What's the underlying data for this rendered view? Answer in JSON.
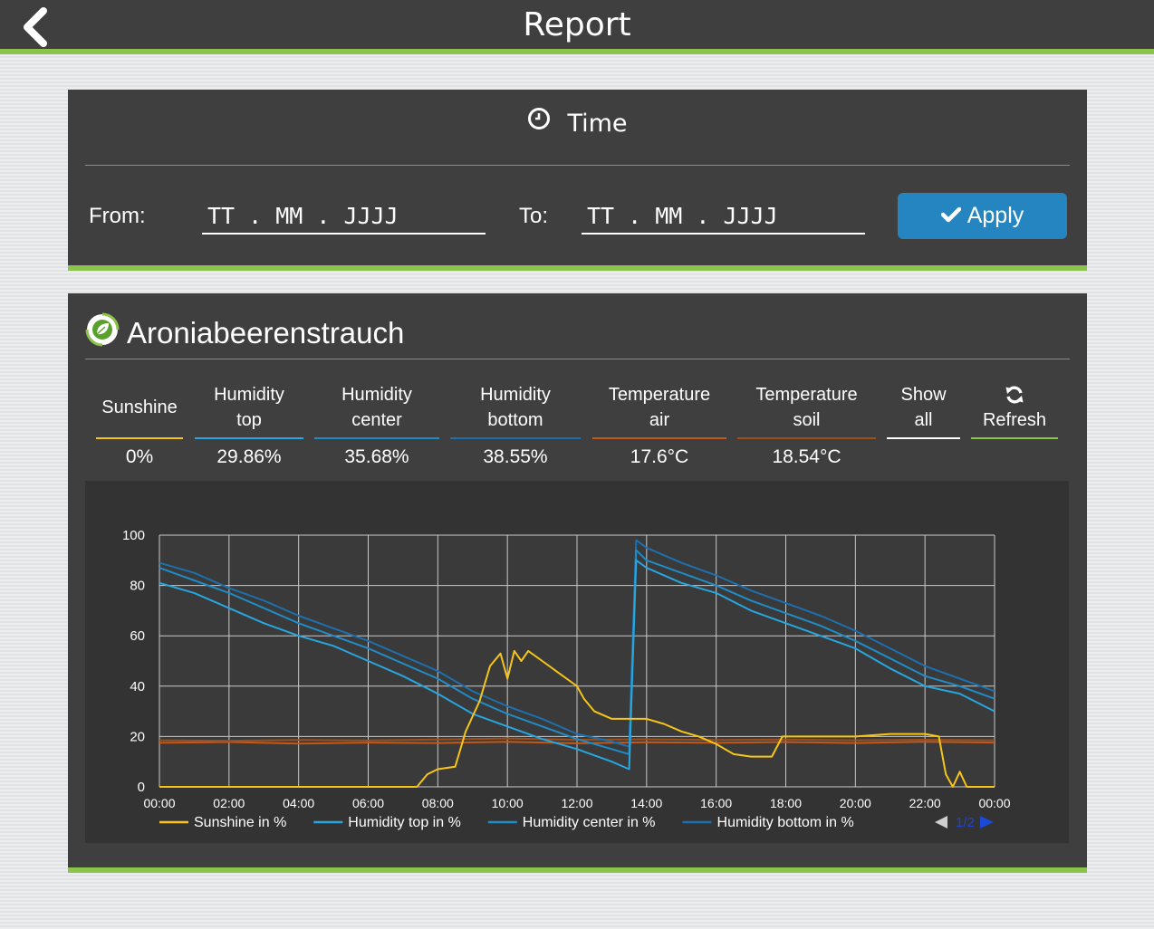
{
  "header": {
    "title": "Report"
  },
  "time": {
    "title": "Time",
    "from_label": "From:",
    "to_label": "To:",
    "from_placeholder": "TT . MM . JJJJ",
    "to_placeholder": "TT . MM . JJJJ",
    "apply_label": "Apply"
  },
  "plant": {
    "name": "Aroniabeerenstrauch",
    "tabs": [
      {
        "line1": "Sunshine",
        "line2": "",
        "value": "0%",
        "color": "#f5c518"
      },
      {
        "line1": "Humidity",
        "line2": "top",
        "value": "29.86%",
        "color": "#27a6e0"
      },
      {
        "line1": "Humidity",
        "line2": "center",
        "value": "35.68%",
        "color": "#1f8cc8"
      },
      {
        "line1": "Humidity",
        "line2": "bottom",
        "value": "38.55%",
        "color": "#1d6fad"
      },
      {
        "line1": "Temperature",
        "line2": "air",
        "value": "17.6°C",
        "color": "#c2581a"
      },
      {
        "line1": "Temperature",
        "line2": "soil",
        "value": "18.54°C",
        "color": "#9e4e1b"
      },
      {
        "line1": "Show",
        "line2": "all",
        "value": "",
        "color": "#ffffff"
      },
      {
        "line1": "Refresh",
        "line2": "",
        "value": "",
        "color": "#8cc34a",
        "icon": "refresh-icon"
      }
    ]
  },
  "chart_data": {
    "type": "line",
    "x": [
      "00:00",
      "02:00",
      "04:00",
      "06:00",
      "08:00",
      "10:00",
      "12:00",
      "14:00",
      "16:00",
      "18:00",
      "20:00",
      "22:00",
      "00:00"
    ],
    "ylim": [
      0,
      100
    ],
    "yticks": [
      0,
      20,
      40,
      60,
      80,
      100
    ],
    "grid": true,
    "legend_position": "bottom",
    "pager": "1/2",
    "series": [
      {
        "name": "Sunshine in %",
        "color": "#f5c518",
        "points": [
          [
            0,
            0
          ],
          [
            7.4,
            0
          ],
          [
            7.7,
            5
          ],
          [
            8.0,
            7
          ],
          [
            8.5,
            8
          ],
          [
            8.8,
            22
          ],
          [
            9.2,
            34
          ],
          [
            9.5,
            48
          ],
          [
            9.8,
            53
          ],
          [
            10.0,
            43
          ],
          [
            10.2,
            54
          ],
          [
            10.4,
            50
          ],
          [
            10.6,
            54
          ],
          [
            11.0,
            50
          ],
          [
            11.5,
            45
          ],
          [
            12.0,
            40
          ],
          [
            12.2,
            35
          ],
          [
            12.5,
            30
          ],
          [
            13.0,
            27
          ],
          [
            13.5,
            27
          ],
          [
            14.0,
            27
          ],
          [
            14.5,
            25
          ],
          [
            15.0,
            22
          ],
          [
            15.5,
            20
          ],
          [
            16.0,
            17
          ],
          [
            16.5,
            13
          ],
          [
            17.0,
            12
          ],
          [
            17.6,
            12
          ],
          [
            17.9,
            20
          ],
          [
            18.5,
            20
          ],
          [
            19.0,
            20
          ],
          [
            20.0,
            20
          ],
          [
            21.0,
            21
          ],
          [
            22.0,
            21
          ],
          [
            22.4,
            20
          ],
          [
            22.6,
            5
          ],
          [
            22.8,
            0
          ],
          [
            23.0,
            6
          ],
          [
            23.2,
            0
          ],
          [
            24,
            0
          ]
        ]
      },
      {
        "name": "Humidity top in %",
        "color": "#27a6e0",
        "points": [
          [
            0,
            81
          ],
          [
            1,
            77
          ],
          [
            2,
            71
          ],
          [
            3,
            65
          ],
          [
            4,
            60
          ],
          [
            5,
            56
          ],
          [
            6,
            50
          ],
          [
            7,
            44
          ],
          [
            8,
            37
          ],
          [
            9,
            29
          ],
          [
            10,
            24
          ],
          [
            11,
            19
          ],
          [
            12,
            15
          ],
          [
            13,
            10
          ],
          [
            13.5,
            7
          ],
          [
            13.7,
            90
          ],
          [
            14,
            87
          ],
          [
            15,
            81
          ],
          [
            16,
            77
          ],
          [
            17,
            70
          ],
          [
            18,
            65
          ],
          [
            19,
            60
          ],
          [
            20,
            55
          ],
          [
            21,
            47
          ],
          [
            22,
            40
          ],
          [
            23,
            37
          ],
          [
            24,
            30
          ]
        ]
      },
      {
        "name": "Humidity center in %",
        "color": "#1f8cc8",
        "points": [
          [
            0,
            87
          ],
          [
            1,
            82
          ],
          [
            2,
            77
          ],
          [
            3,
            71
          ],
          [
            4,
            65
          ],
          [
            5,
            60
          ],
          [
            6,
            55
          ],
          [
            7,
            49
          ],
          [
            8,
            43
          ],
          [
            9,
            35
          ],
          [
            10,
            29
          ],
          [
            11,
            24
          ],
          [
            12,
            19
          ],
          [
            13,
            15
          ],
          [
            13.5,
            13
          ],
          [
            13.7,
            94
          ],
          [
            14,
            90
          ],
          [
            15,
            85
          ],
          [
            16,
            80
          ],
          [
            17,
            74
          ],
          [
            18,
            69
          ],
          [
            19,
            64
          ],
          [
            20,
            58
          ],
          [
            21,
            51
          ],
          [
            22,
            44
          ],
          [
            23,
            40
          ],
          [
            24,
            35
          ]
        ]
      },
      {
        "name": "Humidity bottom in %",
        "color": "#1d6fad",
        "points": [
          [
            0,
            89
          ],
          [
            1,
            85
          ],
          [
            2,
            79
          ],
          [
            3,
            74
          ],
          [
            4,
            68
          ],
          [
            5,
            63
          ],
          [
            6,
            58
          ],
          [
            7,
            52
          ],
          [
            8,
            46
          ],
          [
            9,
            38
          ],
          [
            10,
            32
          ],
          [
            11,
            27
          ],
          [
            12,
            21
          ],
          [
            13,
            18
          ],
          [
            13.5,
            16
          ],
          [
            13.7,
            98
          ],
          [
            14,
            95
          ],
          [
            15,
            89
          ],
          [
            16,
            84
          ],
          [
            17,
            78
          ],
          [
            18,
            73
          ],
          [
            19,
            68
          ],
          [
            20,
            62
          ],
          [
            21,
            55
          ],
          [
            22,
            48
          ],
          [
            23,
            43
          ],
          [
            24,
            38
          ]
        ]
      },
      {
        "name": "Temperature air",
        "color": "#c2581a",
        "points": [
          [
            0,
            17.5
          ],
          [
            2,
            17.8
          ],
          [
            4,
            17.2
          ],
          [
            6,
            17.6
          ],
          [
            8,
            17.4
          ],
          [
            10,
            17.9
          ],
          [
            12,
            17.3
          ],
          [
            14,
            17.7
          ],
          [
            16,
            17.5
          ],
          [
            18,
            17.8
          ],
          [
            20,
            17.4
          ],
          [
            22,
            17.9
          ],
          [
            24,
            17.6
          ]
        ]
      },
      {
        "name": "Temperature soil",
        "color": "#9e4e1b",
        "points": [
          [
            0,
            18.5
          ],
          [
            2,
            18.3
          ],
          [
            4,
            18.6
          ],
          [
            6,
            18.4
          ],
          [
            8,
            18.8
          ],
          [
            10,
            19.2
          ],
          [
            12,
            18.7
          ],
          [
            14,
            18.9
          ],
          [
            16,
            18.6
          ],
          [
            18,
            18.8
          ],
          [
            20,
            18.5
          ],
          [
            22,
            18.7
          ],
          [
            24,
            18.5
          ]
        ]
      }
    ],
    "legend": [
      {
        "name": "Sunshine in %",
        "color": "#f5c518"
      },
      {
        "name": "Humidity top in %",
        "color": "#27a6e0"
      },
      {
        "name": "Humidity center in %",
        "color": "#1f8cc8"
      },
      {
        "name": "Humidity bottom in %",
        "color": "#1d6fad"
      }
    ]
  }
}
